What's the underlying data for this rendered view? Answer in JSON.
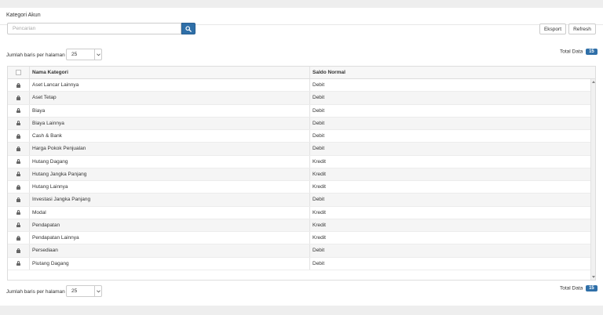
{
  "panel": {
    "title": "Kategori Akun"
  },
  "search": {
    "placeholder": "Pencarian",
    "value": ""
  },
  "toolbar": {
    "export_label": "Eksport",
    "refresh_label": "Refresh"
  },
  "pagination_top": {
    "rows_label": "Jumlah baris per halaman",
    "rows_value": "25",
    "total_label": "Total Data",
    "total_count": "15"
  },
  "pagination_bottom": {
    "rows_label": "Jumlah baris per halaman",
    "rows_value": "25",
    "total_label": "Total Data",
    "total_count": "15"
  },
  "table": {
    "columns": {
      "name": "Nama Kategori",
      "saldo": "Saldo Normal"
    },
    "rows": [
      {
        "name": "Aset Lancar Lainnya",
        "saldo": "Debit"
      },
      {
        "name": "Aset Tetap",
        "saldo": "Debit"
      },
      {
        "name": "Biaya",
        "saldo": "Debit"
      },
      {
        "name": "Biaya Lainnya",
        "saldo": "Debit"
      },
      {
        "name": "Cash & Bank",
        "saldo": "Debit"
      },
      {
        "name": "Harga Pokok Penjualan",
        "saldo": "Debit"
      },
      {
        "name": "Hutang Dagang",
        "saldo": "Kredit"
      },
      {
        "name": "Hutang Jangka Panjang",
        "saldo": "Kredit"
      },
      {
        "name": "Hutang Lainnya",
        "saldo": "Kredit"
      },
      {
        "name": "Investasi Jangka Panjang",
        "saldo": "Debit"
      },
      {
        "name": "Modal",
        "saldo": "Kredit"
      },
      {
        "name": "Pendapatan",
        "saldo": "Kredit"
      },
      {
        "name": "Pendapatan Lainnya",
        "saldo": "Kredit"
      },
      {
        "name": "Persediaan",
        "saldo": "Debit"
      },
      {
        "name": "Piutang Dagang",
        "saldo": "Debit"
      }
    ]
  },
  "icons": {
    "search": "search-icon",
    "row": "lock-icon",
    "select": "chevron-down-icon"
  },
  "colors": {
    "accent": "#2f6fa8",
    "border": "#dddddd",
    "row_alt": "#f5f5f5"
  }
}
